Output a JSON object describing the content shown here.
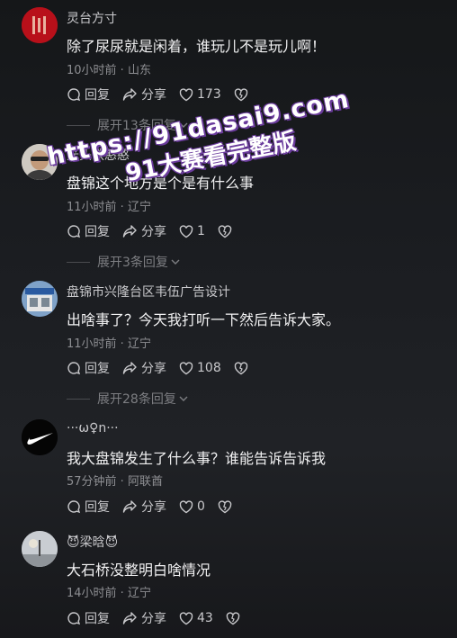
{
  "comments": [
    {
      "name": "灵台方寸",
      "text": "除了尿尿就是闲着，谁玩儿不是玩儿啊！",
      "meta": "10小时前 · 山东",
      "reply_label": "回复",
      "share_label": "分享",
      "likes": "173",
      "expand": "展开13条回复"
    },
    {
      "name": "光头铁憨憨",
      "text": "盘锦这个地方是个是有什么事",
      "meta": "11小时前 · 辽宁",
      "reply_label": "回复",
      "share_label": "分享",
      "likes": "1",
      "expand": "展开3条回复"
    },
    {
      "name": "盘锦市兴隆台区韦伍广告设计",
      "text": "出啥事了？今天我打听一下然后告诉大家。",
      "meta": "11小时前 · 辽宁",
      "reply_label": "回复",
      "share_label": "分享",
      "likes": "108",
      "expand": "展开28条回复"
    },
    {
      "name": "···ω♀n···",
      "text": "我大盘锦发生了什么事？谁能告诉告诉我",
      "meta": "57分钟前 · 阿联酋",
      "reply_label": "回复",
      "share_label": "分享",
      "likes": "0"
    },
    {
      "name": "😈梁晗😈",
      "text": "大石桥没整明白啥情况",
      "meta": "14小时前 · 辽宁",
      "reply_label": "回复",
      "share_label": "分享",
      "likes": "43"
    }
  ],
  "watermark": {
    "line1": "https://91dasai9.com",
    "line2": "91大赛看完整版"
  },
  "colors": {
    "accent_red": "#c0121b",
    "text_primary": "#f1f1f2",
    "text_secondary": "#8d8e92"
  }
}
